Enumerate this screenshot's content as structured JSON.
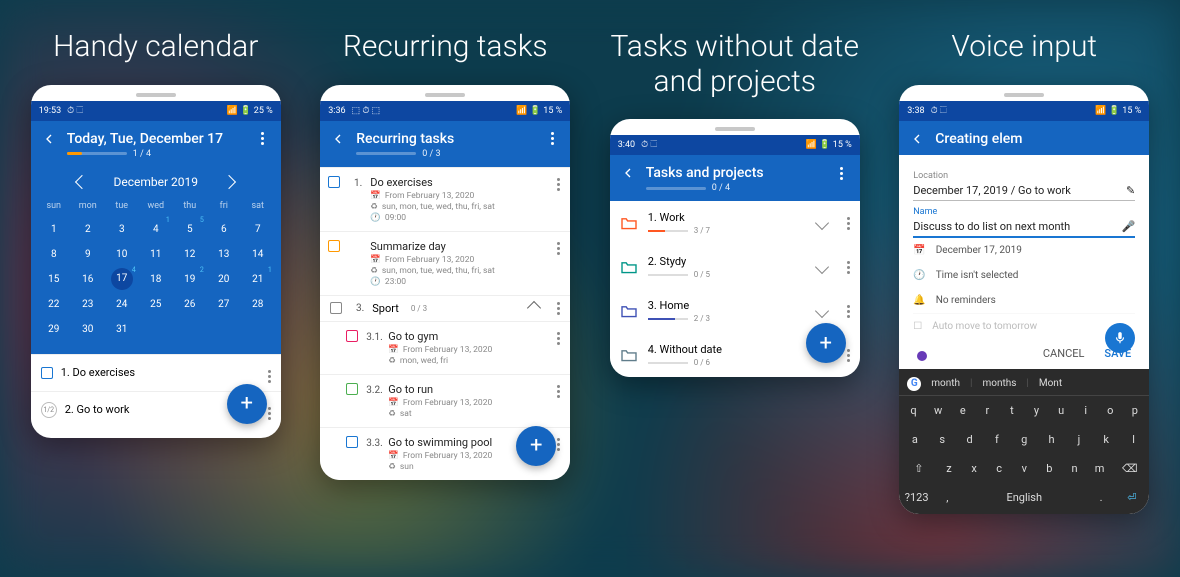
{
  "headlines": [
    "Handy\ncalendar",
    "Recurring\ntasks",
    "Tasks without date\nand projects",
    "Voice input"
  ],
  "p1": {
    "status": {
      "time": "19:53",
      "battery": "25 %"
    },
    "title": "Today, Tue, December 17",
    "progress": "1 / 4",
    "month": "December 2019",
    "dows": [
      "sun",
      "mon",
      "tue",
      "wed",
      "thu",
      "fri",
      "sat"
    ],
    "weeks": [
      [
        {
          "n": 1
        },
        {
          "n": 2
        },
        {
          "n": 3
        },
        {
          "n": 4,
          "b": "1"
        },
        {
          "n": 5,
          "b": "5"
        },
        {
          "n": 6
        },
        {
          "n": 7
        }
      ],
      [
        {
          "n": 8
        },
        {
          "n": 9
        },
        {
          "n": 10
        },
        {
          "n": 11
        },
        {
          "n": 12
        },
        {
          "n": 13
        },
        {
          "n": 14
        }
      ],
      [
        {
          "n": 15
        },
        {
          "n": 16
        },
        {
          "n": 17,
          "today": true,
          "b": "4"
        },
        {
          "n": 18
        },
        {
          "n": 19,
          "b": "2"
        },
        {
          "n": 20
        },
        {
          "n": 21,
          "b": "1"
        }
      ],
      [
        {
          "n": 22
        },
        {
          "n": 23
        },
        {
          "n": 24
        },
        {
          "n": 25
        },
        {
          "n": 26
        },
        {
          "n": 27
        },
        {
          "n": 28
        }
      ],
      [
        {
          "n": 29
        },
        {
          "n": 30
        },
        {
          "n": 31
        },
        {
          "n": ""
        },
        {
          "n": ""
        },
        {
          "n": ""
        },
        {
          "n": ""
        }
      ]
    ],
    "tasks": [
      {
        "idx": "1.",
        "title": "Do exercises",
        "kind": "check"
      },
      {
        "idx": "2.",
        "title": "Go to work",
        "kind": "step",
        "step": "1/2"
      }
    ]
  },
  "p2": {
    "status": {
      "time": "3:36",
      "battery": "15 %"
    },
    "title": "Recurring tasks",
    "progress": "0 / 3",
    "items": [
      {
        "idx": "1.",
        "title": "Do exercises",
        "from": "From February 13, 2020",
        "days": "sun, mon, tue, wed, thu, fri, sat",
        "time": "09:00"
      },
      {
        "idx": "",
        "title": "Summarize day",
        "from": "From February 13, 2020",
        "days": "sun, mon, tue, wed, thu, fri, sat",
        "time": "23:00",
        "color": "c-orange"
      }
    ],
    "group": {
      "idx": "3.",
      "title": "Sport",
      "progress": "0 / 3"
    },
    "sub": [
      {
        "idx": "3.1.",
        "title": "Go to gym",
        "from": "From February 13, 2020",
        "days": "mon, wed, fri",
        "color": "c-pink"
      },
      {
        "idx": "3.2.",
        "title": "Go to run",
        "from": "From February 13, 2020",
        "days": "sat",
        "color": "c-green"
      },
      {
        "idx": "3.3.",
        "title": "Go to swimming pool",
        "from": "From February 13, 2020",
        "days": "sun",
        "color": "c-blue"
      }
    ]
  },
  "p3": {
    "status": {
      "time": "3:40",
      "battery": "15 %"
    },
    "title": "Tasks and projects",
    "progress": "0 / 4",
    "projects": [
      {
        "title": "1. Work",
        "done": 3,
        "total": 7,
        "color": "#ff5722"
      },
      {
        "title": "2. Stydy",
        "done": 0,
        "total": 5,
        "color": "#009688"
      },
      {
        "title": "3. Home",
        "done": 2,
        "total": 3,
        "color": "#3f51b5"
      },
      {
        "title": "4. Without date",
        "done": 0,
        "total": 6,
        "color": "#607d8b"
      }
    ]
  },
  "p4": {
    "status": {
      "time": "3:38",
      "battery": "15 %"
    },
    "title": "Creating elem",
    "loc_label": "Location",
    "loc_val": "December 17, 2019 / Go to work",
    "name_label": "Name",
    "name_val": "Discuss to do list on next month",
    "date": "December 17, 2019",
    "time": "Time isn't selected",
    "rem": "No reminders",
    "auto": "Auto move to tomorrow",
    "cancel": "CANCEL",
    "save": "SAVE",
    "sugg": [
      "month",
      "months",
      "Mont"
    ],
    "rows": [
      [
        "q",
        "w",
        "e",
        "r",
        "t",
        "y",
        "u",
        "i",
        "o",
        "p"
      ],
      [
        "a",
        "s",
        "d",
        "f",
        "g",
        "h",
        "j",
        "k",
        "l"
      ],
      [
        "⇧",
        "z",
        "x",
        "c",
        "v",
        "b",
        "n",
        "m",
        "⌫"
      ]
    ],
    "lang": "English"
  }
}
